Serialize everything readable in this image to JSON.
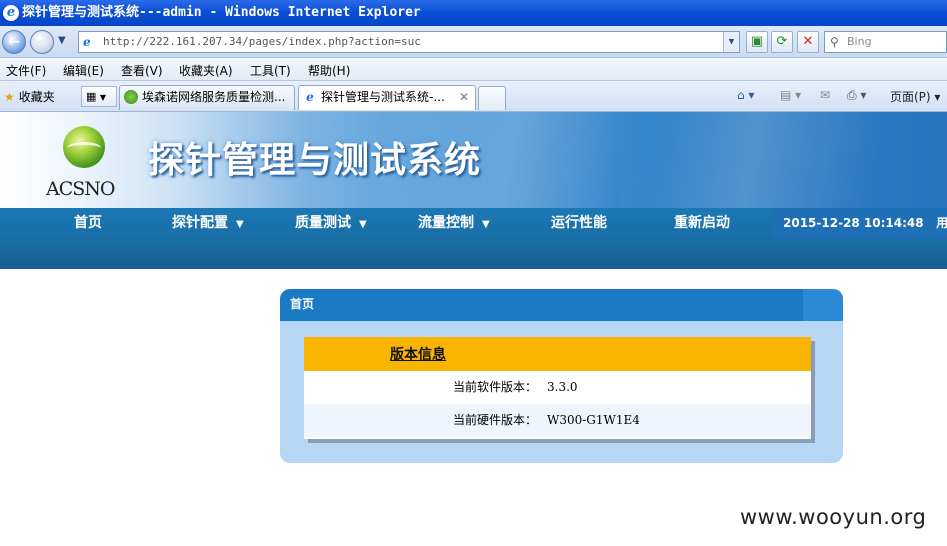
{
  "window": {
    "title": "探针管理与测试系统---admin - Windows Internet Explorer"
  },
  "address_bar": {
    "url": "http://222.161.207.34/pages/index.php?action=suc",
    "search_placeholder": "Bing"
  },
  "menu": [
    "文件(F)",
    "编辑(E)",
    "查看(V)",
    "收藏夹(A)",
    "工具(T)",
    "帮助(H)"
  ],
  "favorites_bar": {
    "label": "收藏夹"
  },
  "tabs": [
    {
      "label": "埃森诺网络服务质量检测...",
      "active": false
    },
    {
      "label": "探针管理与测试系统-...",
      "active": true
    }
  ],
  "command_bar": {
    "page_label": "页面(P)"
  },
  "site": {
    "logo_text": "ACSNO",
    "title": "探针管理与测试系统",
    "nav": [
      {
        "label": "首页",
        "dropdown": false
      },
      {
        "label": "探针配置",
        "dropdown": true
      },
      {
        "label": "质量测试",
        "dropdown": true
      },
      {
        "label": "流量控制",
        "dropdown": true
      },
      {
        "label": "运行性能",
        "dropdown": false
      },
      {
        "label": "重新启动",
        "dropdown": false
      }
    ],
    "datetime": "2015-12-28 10:14:48",
    "user_label": "用户："
  },
  "panel": {
    "header": "首页",
    "card_title": "版本信息",
    "rows": [
      {
        "label": "当前软件版本：",
        "value": "3.3.0"
      },
      {
        "label": "当前硬件版本：",
        "value": "W300-G1W1E4"
      }
    ]
  },
  "watermark": "www.wooyun.org",
  "colors": {
    "nav_bg": "#1a6fa8",
    "panel_header": "#1a7ac4",
    "card_header": "#f8b400",
    "panel_bg": "#b7d6f3"
  }
}
